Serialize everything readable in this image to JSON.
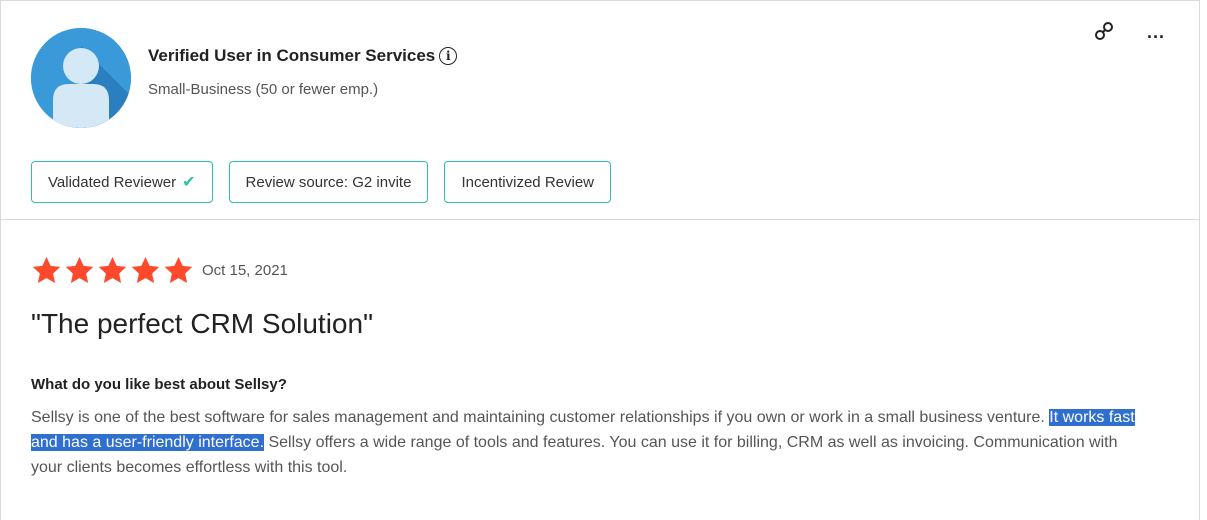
{
  "reviewer": {
    "name": "Verified User in Consumer Services",
    "segment": "Small-Business (50 or fewer emp.)",
    "info_glyph": "i"
  },
  "actions": {
    "link_icon": "link-icon",
    "more_label": "..."
  },
  "badges": [
    {
      "label": "Validated Reviewer",
      "check": "✔"
    },
    {
      "label": "Review source: G2 invite"
    },
    {
      "label": "Incentivized Review"
    }
  ],
  "review": {
    "rating": 5,
    "max_rating": 5,
    "date": "Oct 15, 2021",
    "title": "\"The perfect CRM Solution\"",
    "question": "What do you like best about Sellsy?",
    "answer_before": "Sellsy is one of the best software for sales management and maintaining customer relationships if you own or work in a small business venture. ",
    "answer_highlight": "It works fast and has a user-friendly interface.",
    "answer_after": " Sellsy offers a wide range of tools and features. You can use it for billing, CRM as well as invoicing. Communication with your clients becomes effortless with this tool."
  },
  "colors": {
    "star": "#ff492c",
    "badge_border": "#2fc0a8",
    "avatar": "#3a9ad9",
    "highlight": "#2f6fd0"
  }
}
